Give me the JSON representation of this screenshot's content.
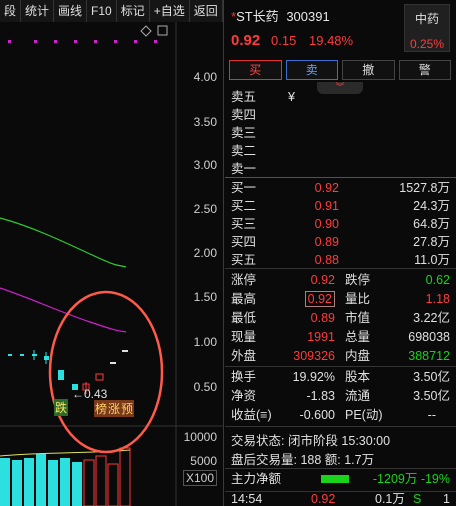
{
  "toolbar": {
    "items": [
      "段",
      "统计",
      "画线",
      "F10",
      "标记",
      "+自选",
      "返回"
    ]
  },
  "chart": {
    "price_axis": [
      "4.00",
      "3.50",
      "3.00",
      "2.50",
      "2.00",
      "1.50",
      "1.00",
      "0.50"
    ],
    "volume_axis": [
      "10000",
      "5000"
    ],
    "volume_unit": "X100",
    "low_marker": "←0.43",
    "tags": {
      "fall": "跌",
      "rank": "榜",
      "rise": "涨",
      "pre": "预"
    },
    "colors": {
      "up": "#ff3b3b",
      "down": "#2de0e0",
      "ma_green": "#2bd12b",
      "ma_magenta": "#d020d0",
      "highlight": "#ff5a4a"
    }
  },
  "stock": {
    "name_prefix": "*",
    "name": "ST长药",
    "code": "300391",
    "price": "0.92",
    "change": "0.15",
    "change_pct": "19.48%",
    "industry": "中药",
    "industry_pct": "0.25%"
  },
  "trade_buttons": {
    "buy": "买",
    "sell": "卖",
    "cancel": "撤",
    "alert": "警"
  },
  "order_book": {
    "sell": [
      {
        "label": "卖五",
        "price": "¥",
        "vol": ""
      },
      {
        "label": "卖四",
        "price": "",
        "vol": ""
      },
      {
        "label": "卖三",
        "price": "",
        "vol": ""
      },
      {
        "label": "卖二",
        "price": "",
        "vol": ""
      },
      {
        "label": "卖一",
        "price": "",
        "vol": ""
      }
    ],
    "buy": [
      {
        "label": "买一",
        "price": "0.92",
        "vol": "1527.8万"
      },
      {
        "label": "买二",
        "price": "0.91",
        "vol": "24.3万"
      },
      {
        "label": "买三",
        "price": "0.90",
        "vol": "64.8万"
      },
      {
        "label": "买四",
        "price": "0.89",
        "vol": "27.8万"
      },
      {
        "label": "买五",
        "price": "0.88",
        "vol": "11.0万"
      }
    ]
  },
  "stats": [
    {
      "l1": "涨停",
      "v1": "0.92",
      "l2": "跌停",
      "v2": "0.62"
    },
    {
      "l1": "最高",
      "v1": "0.92",
      "l2": "量比",
      "v2": "1.18"
    },
    {
      "l1": "最低",
      "v1": "0.89",
      "l2": "市值",
      "v2": "3.22亿"
    },
    {
      "l1": "现量",
      "v1": "1991",
      "l2": "总量",
      "v2": "698038"
    },
    {
      "l1": "外盘",
      "v1": "309326",
      "l2": "内盘",
      "v2": "388712"
    },
    {
      "l1": "换手",
      "v1": "19.92%",
      "l2": "股本",
      "v2": "3.50亿"
    },
    {
      "l1": "净资",
      "v1": "-1.83",
      "l2": "流通",
      "v2": "3.50亿"
    },
    {
      "l1": "收益(≡)",
      "v1": "-0.600",
      "l2": "PE(动)",
      "v2": "--"
    }
  ],
  "status": {
    "trade_state": "交易状态: 闭市阶段 15:30:00",
    "after_hours": "盘后交易量: 188  额: 1.7万"
  },
  "flow": {
    "label": "主力净额",
    "value": "-1209万 -19%"
  },
  "last_tick": {
    "time": "14:54",
    "price": "0.92",
    "vol": "0.1万",
    "side": "S",
    "count": "1"
  }
}
